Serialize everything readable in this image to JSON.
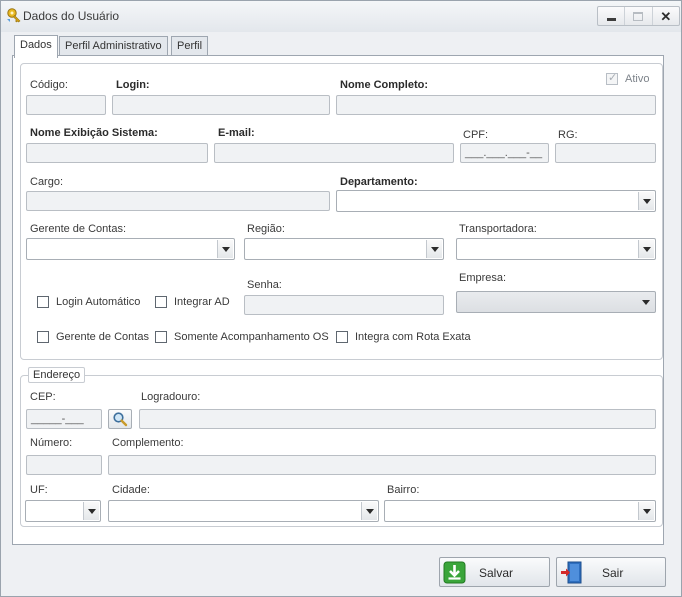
{
  "window": {
    "title": "Dados do Usuário"
  },
  "tabs": [
    {
      "label": "Dados",
      "active": true
    },
    {
      "label": "Perfil Administrativo",
      "active": false
    },
    {
      "label": "Perfil",
      "active": false
    }
  ],
  "form": {
    "codigo": {
      "label": "Código:",
      "value": ""
    },
    "login": {
      "label": "Login:",
      "value": ""
    },
    "nome_completo": {
      "label": "Nome Completo:",
      "value": ""
    },
    "ativo": {
      "label": "Ativo",
      "checked": true,
      "enabled": false
    },
    "nome_exibicao": {
      "label": "Nome Exibição Sistema:",
      "value": ""
    },
    "email": {
      "label": "E-mail:",
      "value": ""
    },
    "cpf": {
      "label": "CPF:",
      "value": "___.___.___-__"
    },
    "rg": {
      "label": "RG:",
      "value": ""
    },
    "cargo": {
      "label": "Cargo:",
      "value": ""
    },
    "departamento": {
      "label": "Departamento:",
      "value": ""
    },
    "gerente_contas_combo": {
      "label": "Gerente de Contas:",
      "value": ""
    },
    "regiao": {
      "label": "Região:",
      "value": ""
    },
    "transportadora": {
      "label": "Transportadora:",
      "value": ""
    },
    "senha": {
      "label": "Senha:",
      "value": ""
    },
    "empresa": {
      "label": "Empresa:",
      "value": "",
      "enabled": false
    },
    "login_automatico": {
      "label": "Login Automático",
      "checked": false
    },
    "integrar_ad": {
      "label": "Integrar AD",
      "checked": false
    },
    "gerente_contas_check": {
      "label": "Gerente de Contas",
      "checked": false
    },
    "somente_acompanhamento": {
      "label": "Somente Acompanhamento OS",
      "checked": false
    },
    "integra_rota_exata": {
      "label": "Integra com Rota Exata",
      "checked": false
    }
  },
  "endereco": {
    "legend": "Endereço",
    "cep": {
      "label": "CEP:",
      "value": "_____-___"
    },
    "logradouro": {
      "label": "Logradouro:",
      "value": ""
    },
    "numero": {
      "label": "Número:",
      "value": ""
    },
    "complemento": {
      "label": "Complemento:",
      "value": ""
    },
    "uf": {
      "label": "UF:",
      "value": ""
    },
    "cidade": {
      "label": "Cidade:",
      "value": ""
    },
    "bairro": {
      "label": "Bairro:",
      "value": ""
    }
  },
  "buttons": {
    "salvar": "Salvar",
    "sair": "Sair"
  },
  "colors": {
    "window_bg": "#eef0f3",
    "field_bg": "#f0f2f4",
    "save_icon_green": "#3aa53a",
    "exit_icon_blue": "#2e6fc0"
  }
}
